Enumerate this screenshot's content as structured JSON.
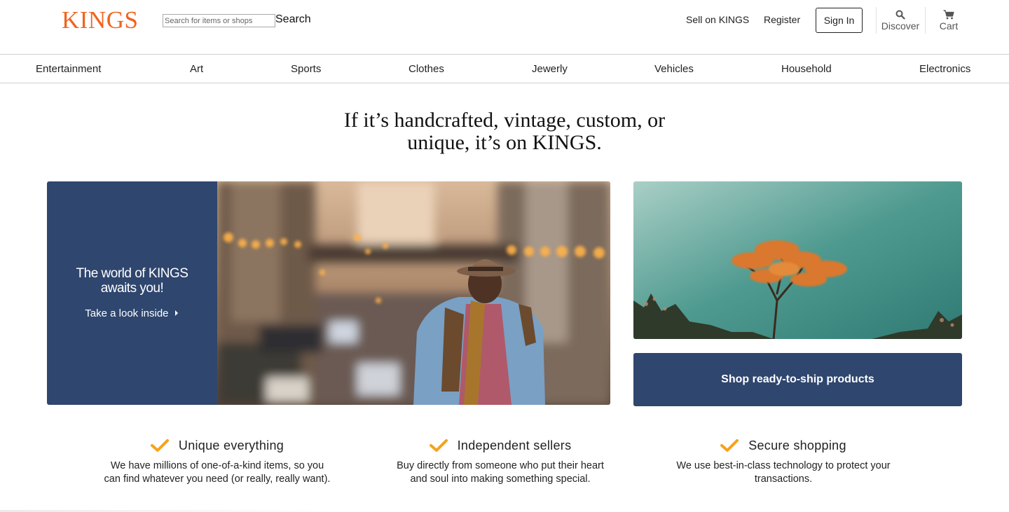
{
  "brand": {
    "name": "KINGS",
    "color": "#f1641e"
  },
  "header": {
    "search_placeholder": "Search for items or shops",
    "search_label": "Search",
    "sell_label": "Sell on KINGS",
    "register_label": "Register",
    "signin_label": "Sign In",
    "discover_label": "Discover",
    "cart_label": "Cart"
  },
  "categories": [
    "Entertainment",
    "Art",
    "Sports",
    "Clothes",
    "Jewerly",
    "Vehicles",
    "Household",
    "Electronics"
  ],
  "hero": {
    "tagline_line1": "If it’s handcrafted, vintage, custom, or",
    "tagline_line2": "unique, it’s on KINGS.",
    "feature_title_line1": "The world of KINGS",
    "feature_title_line2": "awaits you!",
    "feature_link": "Take a look inside",
    "ship_button": "Shop ready-to-ship products"
  },
  "value_props": [
    {
      "icon": "checkmark-icon",
      "title": "Unique everything",
      "text_line1": "We have millions of one-of-a-kind items, so you",
      "text_line2": "can find whatever you need (or really, really want)."
    },
    {
      "icon": "checkmark-icon",
      "title": "Independent sellers",
      "text_line1": "Buy directly from someone who put their heart",
      "text_line2": "and soul into making something special."
    },
    {
      "icon": "checkmark-icon",
      "title": "Secure shopping",
      "text_line1": "We use best-in-class technology to protect your",
      "text_line2": "transactions."
    }
  ],
  "colors": {
    "accent": "#f1641e",
    "navy": "#2f466e",
    "check": "#f6a21b"
  }
}
